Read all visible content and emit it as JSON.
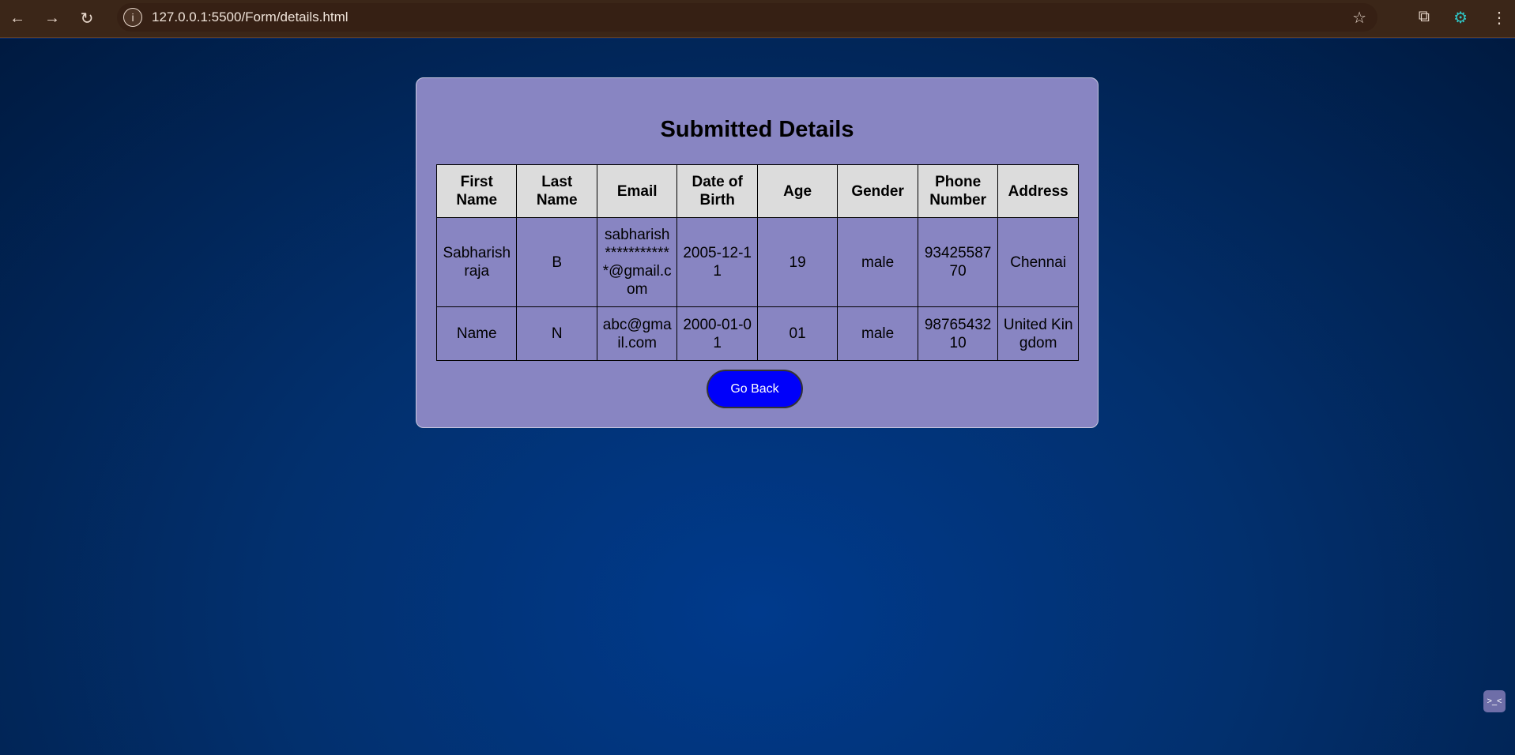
{
  "browser": {
    "url": "127.0.0.1:5500/Form/details.html"
  },
  "page": {
    "title": "Submitted Details",
    "columns": [
      "First Name",
      "Last Name",
      "Email",
      "Date of Birth",
      "Age",
      "Gender",
      "Phone Number",
      "Address"
    ],
    "rows": [
      [
        "Sabharishraja",
        "B",
        "sabharish************@gmail.com",
        "2005-12-11",
        "19",
        "male",
        "9342558770",
        "Chennai"
      ],
      [
        "Name",
        "N",
        "abc@gmail.com",
        "2000-01-01",
        "01",
        "male",
        "9876543210",
        "United Kingdom"
      ]
    ],
    "go_back_label": "Go Back"
  },
  "colors": {
    "card": "#8885c2",
    "button": "#0000fa",
    "header": "#dcdcdc"
  }
}
